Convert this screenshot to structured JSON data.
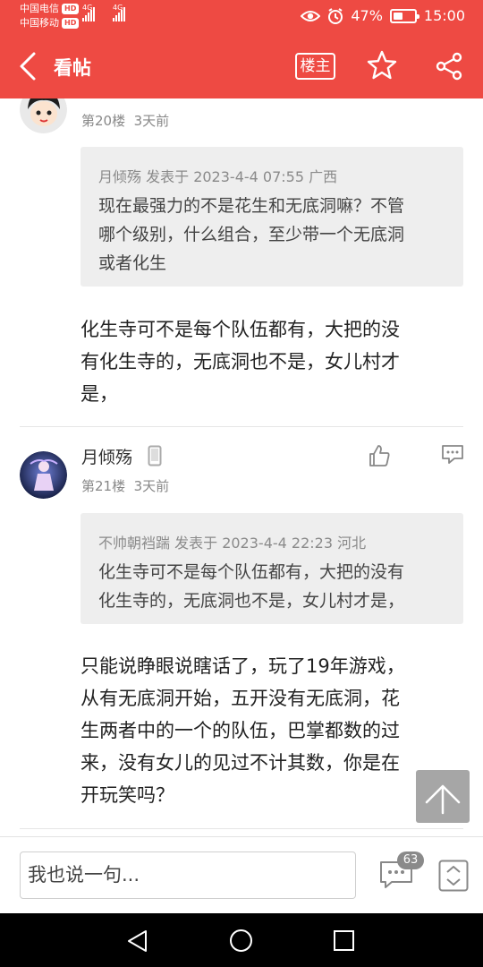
{
  "status_bar": {
    "carrier1": "中国电信",
    "carrier2": "中国移动",
    "hd_badge": "HD",
    "network": "4G",
    "battery_text": "47%",
    "battery_level": 0.47,
    "time": "15:00"
  },
  "header": {
    "title": "看帖",
    "owner_label": "楼主"
  },
  "posts": [
    {
      "floor": "第20楼",
      "time": "3天前",
      "quote": {
        "author": "月倾殇",
        "meta": "发表于 2023-4-4 07:55 广西",
        "lines": [
          "现在最强力的不是花生和无底洞嘛？不管",
          "哪个级别，什么组合，至少带一个无底洞",
          "或者化生"
        ]
      },
      "body_lines": [
        "化生寺可不是每个队伍都有，大把的没",
        "有化生寺的，无底洞也不是，女儿村才",
        "是，"
      ]
    },
    {
      "author": "月倾殇",
      "floor": "第21楼",
      "time": "3天前",
      "quote": {
        "author": "不帅朝裆踹",
        "meta": "发表于 2023-4-4 22:23 河北",
        "lines": [
          "化生寺可不是每个队伍都有，大把的没有",
          "化生寺的，无底洞也不是，女儿村才是，"
        ]
      },
      "body_lines": [
        "只能说睁眼说瞎话了，玩了19年游戏，",
        "从有无底洞开始，五开没有无底洞，花",
        "生两者中的一个的队伍，巴掌都数的过",
        "来，没有女儿的见过不计其数，你是在",
        "开玩笑吗？"
      ]
    }
  ],
  "bottom_bar": {
    "input_placeholder": "我也说一句...",
    "comment_count": "63"
  },
  "colors": {
    "brand": "#ee4a43",
    "quote_bg": "#eeeeee"
  },
  "icons": [
    "back-arrow-icon",
    "star-icon",
    "share-icon",
    "phone-device-icon",
    "like-icon",
    "comment-icon",
    "scroll-to-top-icon",
    "comments-icon",
    "page-scroll-icon"
  ]
}
